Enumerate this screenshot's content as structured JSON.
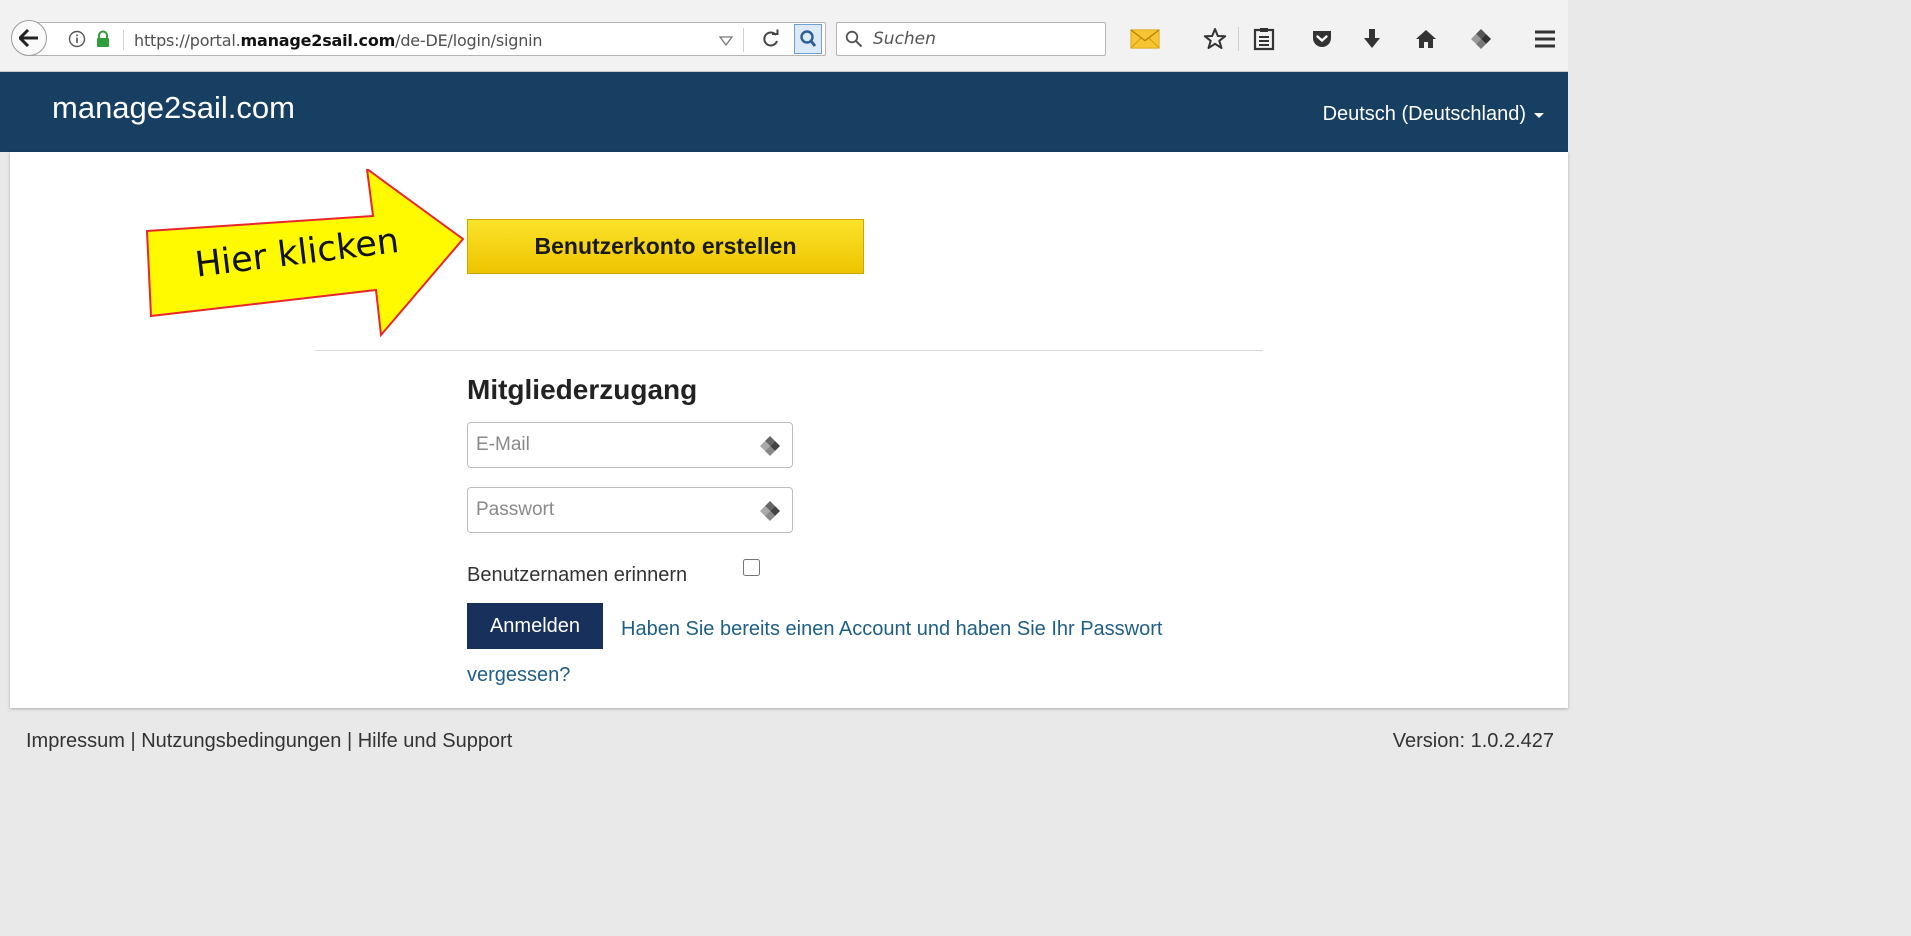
{
  "browser": {
    "url_prefix": "https://portal.",
    "url_domain": "manage2sail.com",
    "url_path": "/de-DE/login/signin",
    "search_placeholder": "Suchen"
  },
  "header": {
    "site_title": "manage2sail.com",
    "language": "Deutsch (Deutschland)"
  },
  "main": {
    "create_account_label": "Benutzerkonto erstellen",
    "section_title": "Mitgliederzugang",
    "email_placeholder": "E-Mail",
    "password_placeholder": "Passwort",
    "remember_label": "Benutzernamen erinnern",
    "remember_checked": false,
    "login_label": "Anmelden",
    "forgot_label": "Haben Sie bereits einen Account und haben Sie Ihr Passwort vergessen?"
  },
  "annotation": {
    "callout_text": "Hier klicken",
    "arrow_color": "#fffa00",
    "arrow_border": "#e8262b"
  },
  "footer": {
    "impressum": "Impressum",
    "nutzungsbedingungen": "Nutzungsbedingungen",
    "hilfe": "Hilfe und Support",
    "separator": "|",
    "version": "Version: 1.0.2.427"
  },
  "colors": {
    "header_bg": "#163f62",
    "create_button": "#f5d20f",
    "login_button": "#17315c",
    "link": "#1f5f86"
  }
}
